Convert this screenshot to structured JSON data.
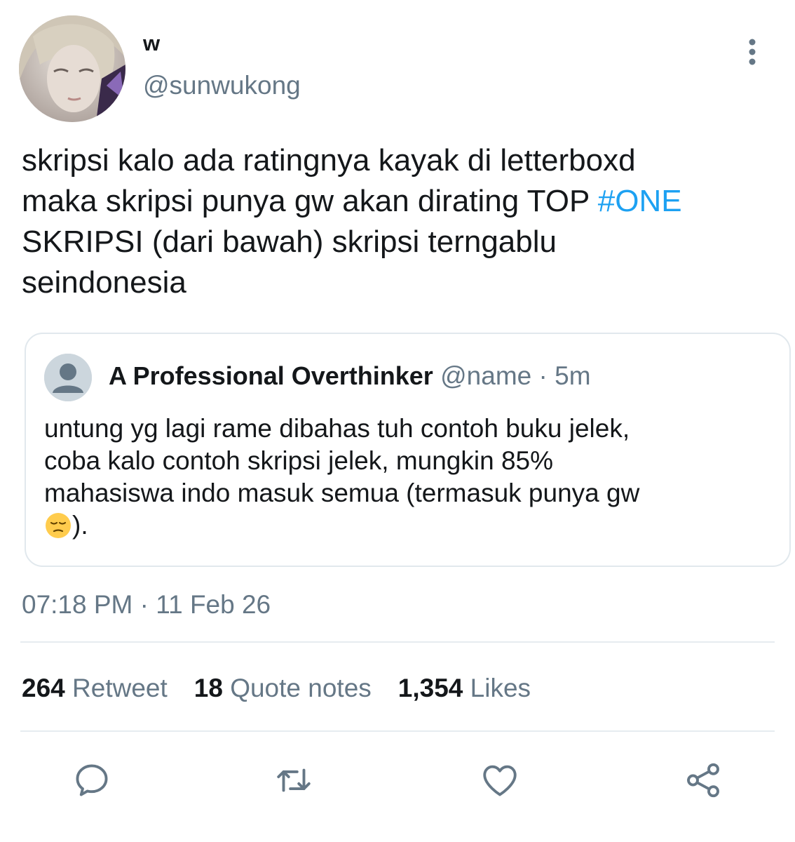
{
  "author": {
    "display_name": "w",
    "handle": "@sunwukong",
    "avatar_icon": "avatar-photo"
  },
  "tweet": {
    "text_lines": [
      "skripsi kalo ada ratingnya kayak di letterboxd",
      "maka skripsi punya gw akan dirating TOP "
    ],
    "hashtag": "#ONE",
    "text_tail": "SKRIPSI (dari bawah) skripsi terngablu\nseindonesia"
  },
  "quoted": {
    "name": "A Professional Overthinker",
    "handle": "@name",
    "separator": " · ",
    "time": "5m",
    "lines": [
      "untung yg lagi rame dibahas tuh contoh buku jelek,",
      "coba kalo contoh skripsi jelek, mungkin 85%",
      "mahasiswa indo masuk semua (termasuk punya gw"
    ],
    "last_line_suffix": ").",
    "emoji_icon": "pensive-face-emoji"
  },
  "timestamp": "07:18 PM · 11 Feb 26",
  "stats": {
    "retweets": {
      "count": "264",
      "label": "Retweet"
    },
    "quotes": {
      "count": "18",
      "label": "Quote notes"
    },
    "likes": {
      "count": "1,354",
      "label": "Likes"
    }
  },
  "actions": [
    "reply-icon",
    "retweet-icon",
    "like-icon",
    "share-icon"
  ],
  "colors": {
    "accent": "#1da1f2",
    "secondary_text": "#657786",
    "divider": "#e6ecf0",
    "icon": "#657786"
  }
}
